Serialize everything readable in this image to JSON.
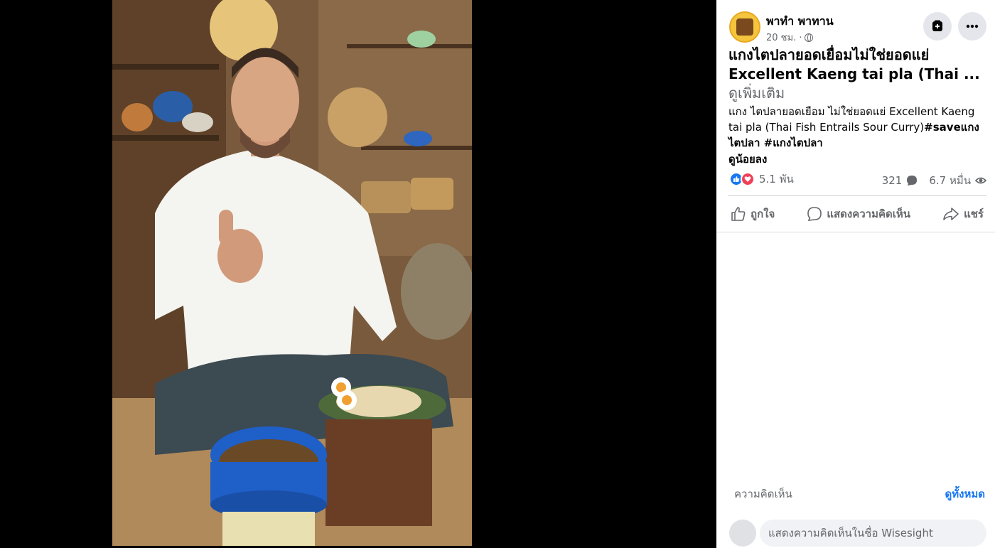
{
  "post": {
    "page_name": "พาทำ พาทาน",
    "time": "20 ชม. ·",
    "title": "แกงไตปลายอดเยื่อมไม่ใช่ยอดแย่ Excellent Kaeng tai pla (Thai ...",
    "see_more": "ดูเพิ่มเติม",
    "description_plain": "แกง ไตปลายอดเยือม ไม่ใช่ยอดแย่ Excellent Kaeng tai pla (Thai Fish Entrails Sour Curry)",
    "description_tags": "#saveแกงไตปลา #แกงไตปลา",
    "see_less": "ดูน้อยลง"
  },
  "stats": {
    "reactions": "5.1 พัน",
    "comments": "321",
    "views": "6.7 หมื่น"
  },
  "actions": {
    "like": "ถูกใจ",
    "comment": "แสดงความคิดเห็น",
    "share": "แชร์"
  },
  "comments": {
    "label": "ความคิดเห็น",
    "view_all": "ดูทั้งหมด",
    "placeholder": "แสดงความคิดเห็นในชื่อ Wisesight"
  },
  "colors": {
    "accent": "#1877f2",
    "love": "#f33e58",
    "muted": "#65676b"
  },
  "icons": [
    "globe-icon",
    "save-icon",
    "more-icon",
    "like-reaction-icon",
    "love-reaction-icon",
    "comment-count-icon",
    "views-eye-icon",
    "thumbs-up-icon",
    "comment-icon",
    "share-icon"
  ]
}
